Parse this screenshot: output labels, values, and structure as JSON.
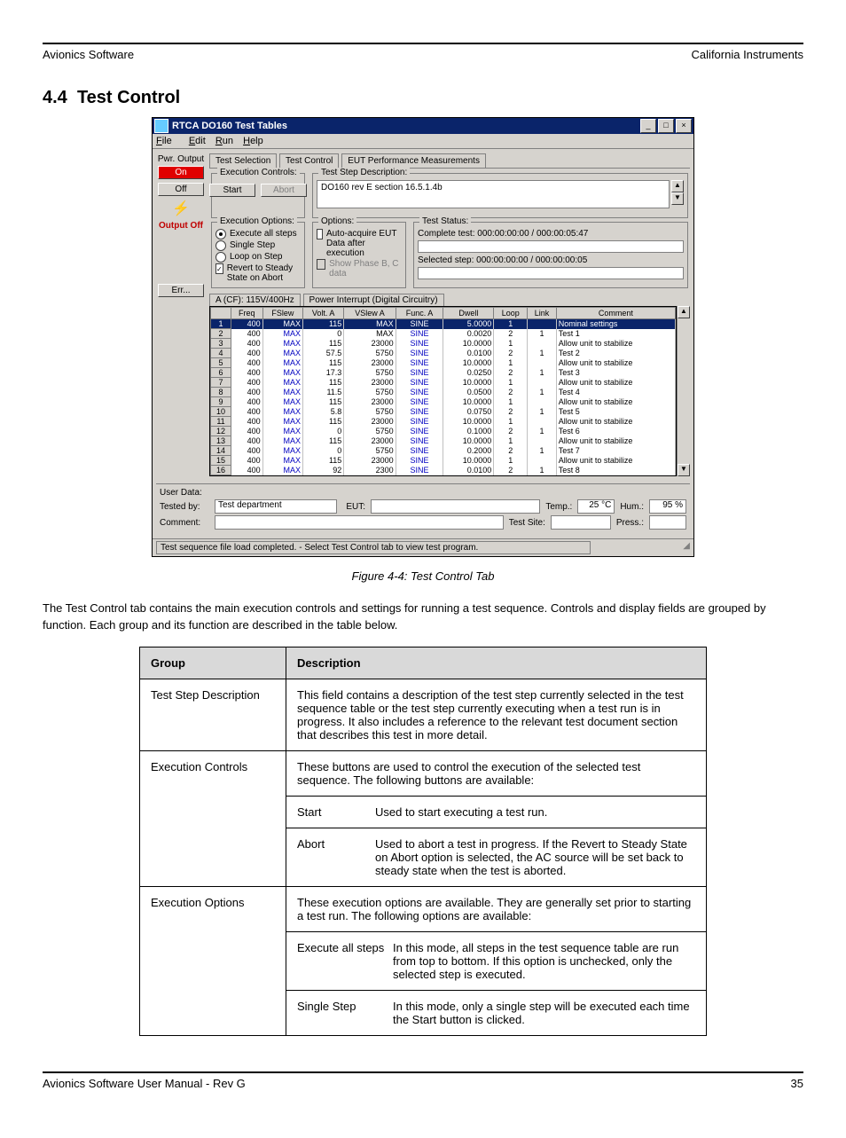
{
  "doc": {
    "header_left": "Avionics Software",
    "header_right": "California Instruments",
    "section_number": "4.4",
    "section_title": "Test Control",
    "figure_caption": "Figure 4-4: Test Control Tab",
    "intro_para": "The Test Control tab contains the main execution controls and settings for running a test sequence. Controls and display fields are grouped by function. Each group and its function are described in the table below.",
    "footer_left": "Avionics Software User Manual - Rev G",
    "footer_right": "35"
  },
  "desc_table": {
    "hdr_group": "Group",
    "hdr_desc": "Description",
    "rows": [
      {
        "group": "Test Step Description",
        "desc": "This field contains a description of the test step currently selected in the test sequence table or the test step currently executing when a test run is in progress. It also includes a reference to the relevant test document section that describes this test in more detail."
      },
      {
        "group": "Execution Controls",
        "desc": "These buttons are used to control the execution of the selected test sequence. The following buttons are available:"
      },
      {
        "group": "",
        "desc": "Start – Used to start executing a test run."
      },
      {
        "group": "",
        "desc": "Abort – Used to abort a test in progress. If the Revert to Steady State on Abort option is selected, the AC source will be set back to steady state when the test is aborted."
      },
      {
        "group": "Execution Options",
        "desc": "These execution options are available. They are generally set prior to starting a test run. The following options are available:"
      },
      {
        "group": "",
        "desc": "Execute all steps – In this mode, all steps in the test sequence table are run from top to bottom. If this option is unchecked, only the selected step is executed."
      },
      {
        "group": "",
        "desc": "Single Step – In this mode, only a single step will be executed each time the Start button is clicked."
      }
    ]
  },
  "win": {
    "title": "RTCA DO160 Test Tables",
    "menu": {
      "file": "File",
      "edit": "Edit",
      "run": "Run",
      "help": "Help"
    },
    "left": {
      "pwr_output": "Pwr. Output",
      "on": "On",
      "off": "Off",
      "output_off": "Output Off",
      "err": "Err..."
    },
    "tabs": {
      "sel": "Test Selection",
      "ctl": "Test Control",
      "eut": "EUT Performance Measurements"
    },
    "step_desc_label": "Test Step Description:",
    "step_desc_value": "DO160 rev E section 16.5.1.4b",
    "exec_ctrl": {
      "label": "Execution Controls:",
      "start": "Start",
      "abort": "Abort"
    },
    "exec_opt": {
      "label": "Execution Options:",
      "all": "Execute all steps",
      "single": "Single Step",
      "loop": "Loop on Step",
      "revert": "Revert to Steady State on Abort"
    },
    "options": {
      "label": "Options:",
      "auto": "Auto-acquire EUT Data after execution",
      "show": "Show Phase B, C data"
    },
    "status": {
      "label": "Test Status:",
      "complete": "Complete test: 000:00:00:00 / 000:00:05:47",
      "selected": "Selected step: 000:00:00:00 / 000:00:00:05"
    },
    "subtabs": {
      "a": "A (CF): 115V/400Hz",
      "b": "Power Interrupt (Digital Circuitry)"
    },
    "cols": [
      "",
      "Freq",
      "FSlew",
      "Volt. A",
      "VSlew A",
      "Func. A",
      "Dwell",
      "Loop",
      "Link",
      "Comment"
    ],
    "rows": [
      {
        "n": 1,
        "f": "400",
        "fs": "MAX",
        "v": "115",
        "vs": "MAX",
        "fn": "SINE",
        "dw": "5.0000",
        "lp": "1",
        "lk": "",
        "cm": "Nominal settings"
      },
      {
        "n": 2,
        "f": "400",
        "fs": "MAX",
        "v": "0",
        "vs": "MAX",
        "fn": "SINE",
        "dw": "0.0020",
        "lp": "2",
        "lk": "1",
        "cm": "Test 1"
      },
      {
        "n": 3,
        "f": "400",
        "fs": "MAX",
        "v": "115",
        "vs": "23000",
        "fn": "SINE",
        "dw": "10.0000",
        "lp": "1",
        "lk": "",
        "cm": "Allow unit to stabilize"
      },
      {
        "n": 4,
        "f": "400",
        "fs": "MAX",
        "v": "57.5",
        "vs": "5750",
        "fn": "SINE",
        "dw": "0.0100",
        "lp": "2",
        "lk": "1",
        "cm": "Test 2"
      },
      {
        "n": 5,
        "f": "400",
        "fs": "MAX",
        "v": "115",
        "vs": "23000",
        "fn": "SINE",
        "dw": "10.0000",
        "lp": "1",
        "lk": "",
        "cm": "Allow unit to stabilize"
      },
      {
        "n": 6,
        "f": "400",
        "fs": "MAX",
        "v": "17.3",
        "vs": "5750",
        "fn": "SINE",
        "dw": "0.0250",
        "lp": "2",
        "lk": "1",
        "cm": "Test 3"
      },
      {
        "n": 7,
        "f": "400",
        "fs": "MAX",
        "v": "115",
        "vs": "23000",
        "fn": "SINE",
        "dw": "10.0000",
        "lp": "1",
        "lk": "",
        "cm": "Allow unit to stabilize"
      },
      {
        "n": 8,
        "f": "400",
        "fs": "MAX",
        "v": "11.5",
        "vs": "5750",
        "fn": "SINE",
        "dw": "0.0500",
        "lp": "2",
        "lk": "1",
        "cm": "Test 4"
      },
      {
        "n": 9,
        "f": "400",
        "fs": "MAX",
        "v": "115",
        "vs": "23000",
        "fn": "SINE",
        "dw": "10.0000",
        "lp": "1",
        "lk": "",
        "cm": "Allow unit to stabilize"
      },
      {
        "n": 10,
        "f": "400",
        "fs": "MAX",
        "v": "5.8",
        "vs": "5750",
        "fn": "SINE",
        "dw": "0.0750",
        "lp": "2",
        "lk": "1",
        "cm": "Test 5"
      },
      {
        "n": 11,
        "f": "400",
        "fs": "MAX",
        "v": "115",
        "vs": "23000",
        "fn": "SINE",
        "dw": "10.0000",
        "lp": "1",
        "lk": "",
        "cm": "Allow unit to stabilize"
      },
      {
        "n": 12,
        "f": "400",
        "fs": "MAX",
        "v": "0",
        "vs": "5750",
        "fn": "SINE",
        "dw": "0.1000",
        "lp": "2",
        "lk": "1",
        "cm": "Test 6"
      },
      {
        "n": 13,
        "f": "400",
        "fs": "MAX",
        "v": "115",
        "vs": "23000",
        "fn": "SINE",
        "dw": "10.0000",
        "lp": "1",
        "lk": "",
        "cm": "Allow unit to stabilize"
      },
      {
        "n": 14,
        "f": "400",
        "fs": "MAX",
        "v": "0",
        "vs": "5750",
        "fn": "SINE",
        "dw": "0.2000",
        "lp": "2",
        "lk": "1",
        "cm": "Test 7"
      },
      {
        "n": 15,
        "f": "400",
        "fs": "MAX",
        "v": "115",
        "vs": "23000",
        "fn": "SINE",
        "dw": "10.0000",
        "lp": "1",
        "lk": "",
        "cm": "Allow unit to stabilize"
      },
      {
        "n": 16,
        "f": "400",
        "fs": "MAX",
        "v": "92",
        "vs": "2300",
        "fn": "SINE",
        "dw": "0.0100",
        "lp": "2",
        "lk": "1",
        "cm": "Test 8"
      }
    ],
    "userdata": {
      "label": "User Data:",
      "tested_by_lbl": "Tested by:",
      "tested_by": "Test department",
      "eut_lbl": "EUT:",
      "temp_lbl": "Temp.:",
      "temp": "25 °C",
      "hum_lbl": "Hum.:",
      "hum": "95 %",
      "comment_lbl": "Comment:",
      "site_lbl": "Test Site:",
      "press_lbl": "Press.:"
    },
    "statusbar": "Test sequence file load completed. - Select Test Control tab to view test program."
  }
}
